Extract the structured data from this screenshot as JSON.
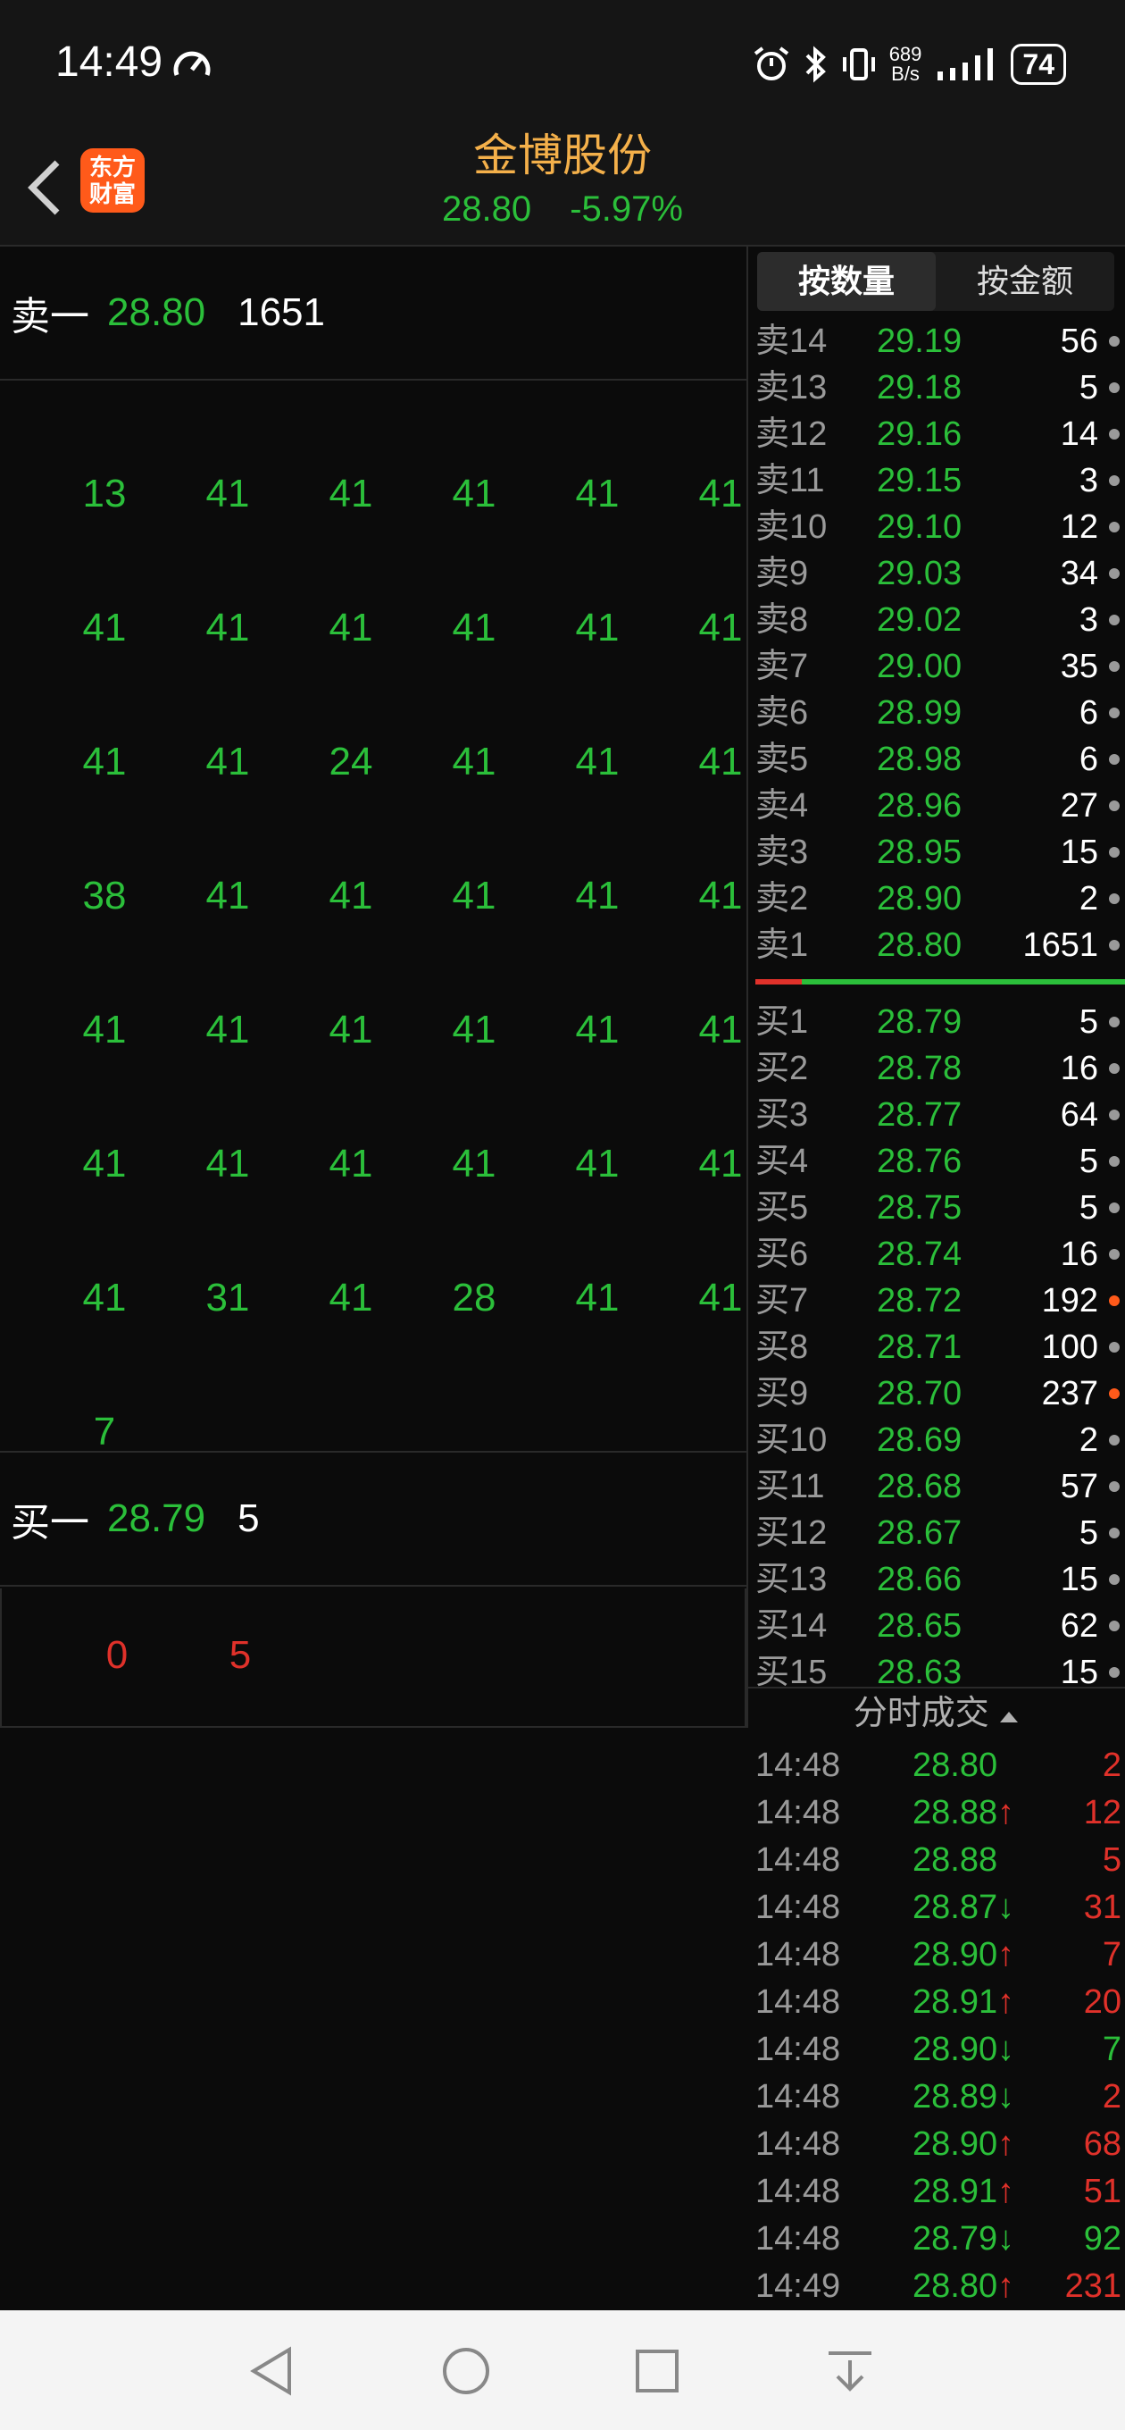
{
  "status": {
    "time": "14:49",
    "net_speed_value": "689",
    "net_speed_unit": "B/s",
    "battery": "74"
  },
  "header": {
    "logo_line1": "东方",
    "logo_line2": "财富",
    "stock_name": "金博股份",
    "price": "28.80",
    "change_pct": "-5.97%"
  },
  "left": {
    "sell_label": "卖一",
    "sell_price": "28.80",
    "sell_volume": "1651",
    "sell_queue": [
      [
        "13",
        "41",
        "41",
        "41",
        "41",
        "41"
      ],
      [
        "41",
        "41",
        "41",
        "41",
        "41",
        "41"
      ],
      [
        "41",
        "41",
        "24",
        "41",
        "41",
        "41"
      ],
      [
        "38",
        "41",
        "41",
        "41",
        "41",
        "41"
      ],
      [
        "41",
        "41",
        "41",
        "41",
        "41",
        "41"
      ],
      [
        "41",
        "41",
        "41",
        "41",
        "41",
        "41"
      ],
      [
        "41",
        "31",
        "41",
        "28",
        "41",
        "41"
      ],
      [
        "7"
      ]
    ],
    "buy_label": "买一",
    "buy_price": "28.79",
    "buy_volume": "5",
    "buy_queue": [
      "0",
      "5"
    ]
  },
  "right": {
    "tabs": [
      {
        "label": "按数量",
        "active": true
      },
      {
        "label": "按金额",
        "active": false
      }
    ],
    "asks": [
      {
        "label": "卖14",
        "price": "29.19",
        "vol": "56",
        "hot": false
      },
      {
        "label": "卖13",
        "price": "29.18",
        "vol": "5",
        "hot": false
      },
      {
        "label": "卖12",
        "price": "29.16",
        "vol": "14",
        "hot": false
      },
      {
        "label": "卖11",
        "price": "29.15",
        "vol": "3",
        "hot": false
      },
      {
        "label": "卖10",
        "price": "29.10",
        "vol": "12",
        "hot": false
      },
      {
        "label": "卖9",
        "price": "29.03",
        "vol": "34",
        "hot": false
      },
      {
        "label": "卖8",
        "price": "29.02",
        "vol": "3",
        "hot": false
      },
      {
        "label": "卖7",
        "price": "29.00",
        "vol": "35",
        "hot": false
      },
      {
        "label": "卖6",
        "price": "28.99",
        "vol": "6",
        "hot": false
      },
      {
        "label": "卖5",
        "price": "28.98",
        "vol": "6",
        "hot": false
      },
      {
        "label": "卖4",
        "price": "28.96",
        "vol": "27",
        "hot": false
      },
      {
        "label": "卖3",
        "price": "28.95",
        "vol": "15",
        "hot": false
      },
      {
        "label": "卖2",
        "price": "28.90",
        "vol": "2",
        "hot": false
      },
      {
        "label": "卖1",
        "price": "28.80",
        "vol": "1651",
        "hot": false
      }
    ],
    "bids": [
      {
        "label": "买1",
        "price": "28.79",
        "vol": "5",
        "hot": false
      },
      {
        "label": "买2",
        "price": "28.78",
        "vol": "16",
        "hot": false
      },
      {
        "label": "买3",
        "price": "28.77",
        "vol": "64",
        "hot": false
      },
      {
        "label": "买4",
        "price": "28.76",
        "vol": "5",
        "hot": false
      },
      {
        "label": "买5",
        "price": "28.75",
        "vol": "5",
        "hot": false
      },
      {
        "label": "买6",
        "price": "28.74",
        "vol": "16",
        "hot": false
      },
      {
        "label": "买7",
        "price": "28.72",
        "vol": "192",
        "hot": true
      },
      {
        "label": "买8",
        "price": "28.71",
        "vol": "100",
        "hot": false
      },
      {
        "label": "买9",
        "price": "28.70",
        "vol": "237",
        "hot": true
      },
      {
        "label": "买10",
        "price": "28.69",
        "vol": "2",
        "hot": false
      },
      {
        "label": "买11",
        "price": "28.68",
        "vol": "57",
        "hot": false
      },
      {
        "label": "买12",
        "price": "28.67",
        "vol": "5",
        "hot": false
      },
      {
        "label": "买13",
        "price": "28.66",
        "vol": "15",
        "hot": false
      },
      {
        "label": "买14",
        "price": "28.65",
        "vol": "62",
        "hot": false
      },
      {
        "label": "买15",
        "price": "28.63",
        "vol": "15",
        "hot": false
      }
    ],
    "ticks_title": "分时成交",
    "ticks": [
      {
        "time": "14:48",
        "price": "28.80",
        "dir": "",
        "vol": "2",
        "vol_color": "red"
      },
      {
        "time": "14:48",
        "price": "28.88",
        "dir": "up",
        "vol": "12",
        "vol_color": "red"
      },
      {
        "time": "14:48",
        "price": "28.88",
        "dir": "",
        "vol": "5",
        "vol_color": "red"
      },
      {
        "time": "14:48",
        "price": "28.87",
        "dir": "down",
        "vol": "31",
        "vol_color": "red"
      },
      {
        "time": "14:48",
        "price": "28.90",
        "dir": "up",
        "vol": "7",
        "vol_color": "red"
      },
      {
        "time": "14:48",
        "price": "28.91",
        "dir": "up",
        "vol": "20",
        "vol_color": "red"
      },
      {
        "time": "14:48",
        "price": "28.90",
        "dir": "down",
        "vol": "7",
        "vol_color": "green"
      },
      {
        "time": "14:48",
        "price": "28.89",
        "dir": "down",
        "vol": "2",
        "vol_color": "red"
      },
      {
        "time": "14:48",
        "price": "28.90",
        "dir": "up",
        "vol": "68",
        "vol_color": "red"
      },
      {
        "time": "14:48",
        "price": "28.91",
        "dir": "up",
        "vol": "51",
        "vol_color": "red"
      },
      {
        "time": "14:48",
        "price": "28.79",
        "dir": "down",
        "vol": "92",
        "vol_color": "green"
      },
      {
        "time": "14:49",
        "price": "28.80",
        "dir": "up",
        "vol": "231",
        "vol_color": "red"
      }
    ]
  },
  "colors": {
    "up": "#e0312a",
    "down": "#2bbf3a",
    "accent": "#f4b04a",
    "logo": "#ff5a1a"
  }
}
